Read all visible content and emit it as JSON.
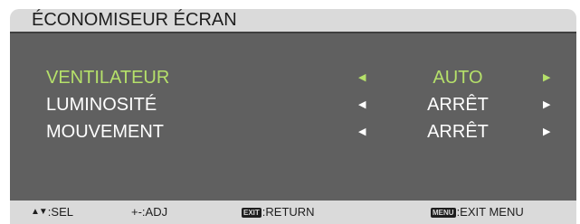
{
  "title": "ÉCONOMISEUR ÉCRAN",
  "menu": {
    "items": [
      {
        "label": "VENTILATEUR",
        "value": "AUTO",
        "selected": true
      },
      {
        "label": "LUMINOSITÉ",
        "value": "ARRÊT",
        "selected": false
      },
      {
        "label": "MOUVEMENT",
        "value": "ARRÊT",
        "selected": false
      }
    ]
  },
  "footer": {
    "sel": {
      "icon": "up-down-arrows",
      "icon_text": "▲▼",
      "text": ":SEL"
    },
    "adj": {
      "text": "+-:ADJ"
    },
    "return": {
      "key": "EXIT",
      "text": ":RETURN"
    },
    "exit_menu": {
      "key": "MENU",
      "text": ":EXIT MENU"
    }
  },
  "colors": {
    "panel": "#606060",
    "bars": "#dadada",
    "selected_text": "#b5e06a",
    "text": "#ffffff"
  }
}
